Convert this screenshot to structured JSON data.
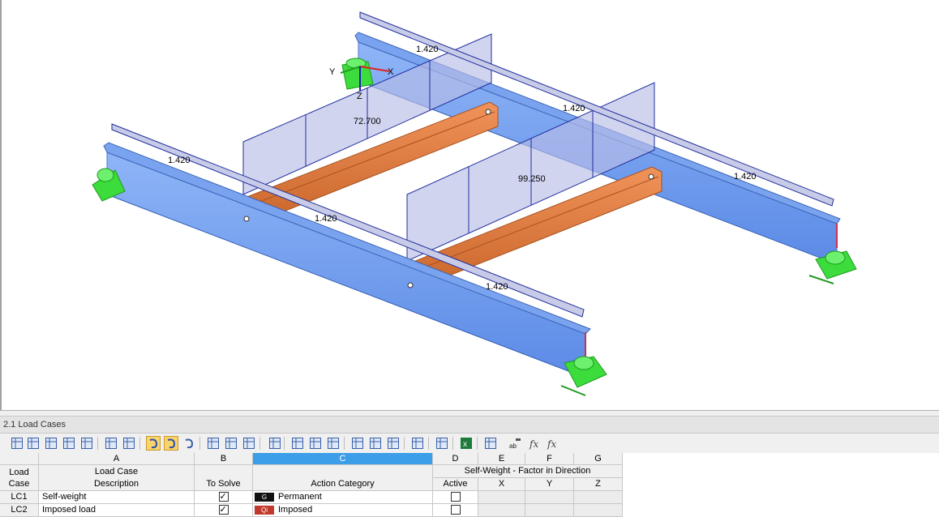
{
  "viewport": {
    "dimensions": {
      "d1": "1.420",
      "d2": "1.420",
      "d3": "1.420",
      "d4": "1.420",
      "d5": "1.420",
      "d6": "1.420",
      "load1": "72.700",
      "load2": "99.250"
    },
    "axes": {
      "x": "X",
      "y": "Y",
      "z": "Z"
    },
    "colors": {
      "main_beam": "#6b9cf0",
      "main_beam_dark": "#4a78d0",
      "cross_beam": "#e07a3c",
      "load_fill": "#b9bde6",
      "load_line": "#1f2f9c",
      "support": "#3cdc3c"
    }
  },
  "panel": {
    "title": "2.1 Load Cases",
    "toolbar_icons": [
      "table-icon",
      "insert-row-icon",
      "delete-row-icon",
      "sort-icon",
      "chart-icon",
      "import-icon",
      "export-icon",
      "undo-icon",
      "redo-icon",
      "refresh-icon",
      "first-icon",
      "prev-icon",
      "next-icon",
      "clear-icon",
      "cut-row-icon",
      "copy-row-icon",
      "paste-row-icon",
      "view-table-icon",
      "view-list-icon",
      "edit-icon",
      "print-icon",
      "link-icon",
      "excel-icon",
      "calculator-icon",
      "text-format-icon",
      "formula-icon",
      "formula-clear-icon"
    ]
  },
  "table": {
    "col_letters": [
      "A",
      "B",
      "C",
      "D",
      "E",
      "F",
      "G"
    ],
    "header": {
      "load_case_1": "Load",
      "load_case_2": "Case",
      "a_top": "Load Case",
      "a_bottom": "Description",
      "b": "To Solve",
      "c": "Action Category",
      "sw_group": "Self-Weight  -  Factor in Direction",
      "d": "Active",
      "e": "X",
      "f": "Y",
      "g": "Z"
    },
    "rows": [
      {
        "id": "LC1",
        "description": "Self-weight",
        "to_solve": true,
        "cat_code": "G",
        "cat_color": "#111111",
        "category": "Permanent",
        "active": false
      },
      {
        "id": "LC2",
        "description": "Imposed load",
        "to_solve": true,
        "cat_code": "Qi",
        "cat_color": "#c0392b",
        "category": "Imposed",
        "active": false
      }
    ]
  }
}
